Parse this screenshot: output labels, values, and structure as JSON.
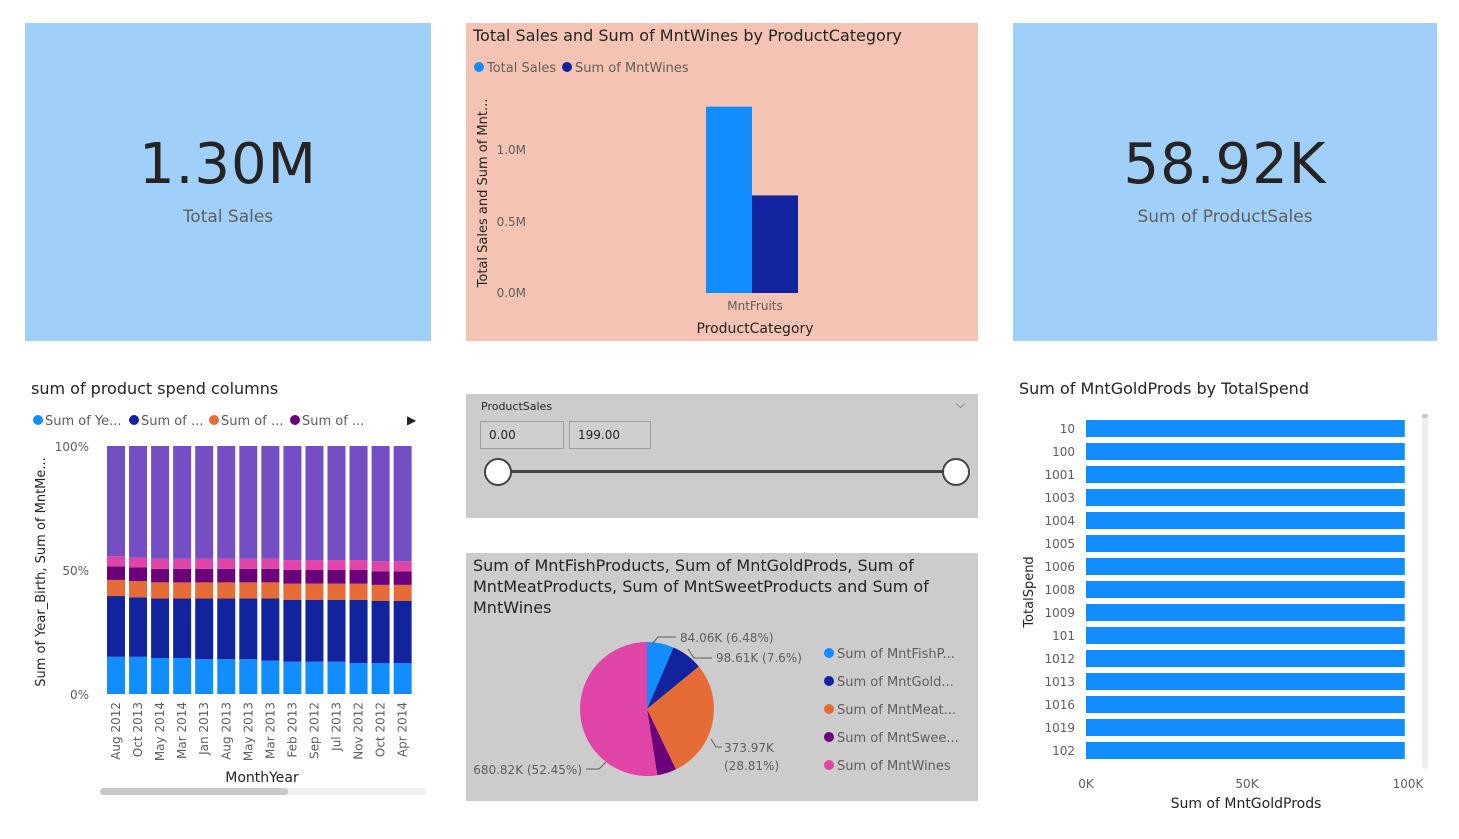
{
  "cards": [
    {
      "value": "1.30M",
      "label": "Total Sales"
    },
    {
      "value": "58.92K",
      "label": "Sum of ProductSales"
    }
  ],
  "colors": {
    "blue": "#118dff",
    "dark_blue": "#12239e",
    "orange": "#e66c37",
    "purple": "#6b007b",
    "pink": "#e044a7",
    "violet": "#744ec2",
    "card_bg": "#a0cff9",
    "salmon_bg": "#f4c3b3",
    "gray_bg": "#cccccc"
  },
  "chart_data": [
    {
      "id": "category_bar",
      "type": "bar",
      "title": "Total Sales and Sum of MntWines by ProductCategory",
      "legend": [
        "Total Sales",
        "Sum of MntWines"
      ],
      "legend_position": "top-left",
      "categories": [
        "MntFruits"
      ],
      "series": [
        {
          "name": "Total Sales",
          "values": [
            1300000
          ]
        },
        {
          "name": "Sum of MntWines",
          "values": [
            680820
          ]
        }
      ],
      "xlabel": "ProductCategory",
      "ylabel": "Total Sales and Sum of Mnt...",
      "yticks": [
        "0.0M",
        "0.5M",
        "1.0M"
      ],
      "ylim": [
        0,
        1500000
      ]
    },
    {
      "id": "stacked_100",
      "type": "bar",
      "stacking": "percent",
      "title": "sum of product spend columns",
      "legend": [
        "Sum of Ye...",
        "Sum of ...",
        "Sum of ...",
        "Sum of ..."
      ],
      "categories": [
        "Aug 2012",
        "Oct 2013",
        "May 2014",
        "Mar 2014",
        "Jan 2013",
        "Aug 2013",
        "May 2013",
        "Mar 2013",
        "Feb 2013",
        "Sep 2012",
        "Jul 2013",
        "Nov 2012",
        "Oct 2012",
        "Apr 2014"
      ],
      "series_colors": [
        "#118dff",
        "#12239e",
        "#e66c37",
        "#6b007b",
        "#e044a7",
        "#744ec2"
      ],
      "series": [
        {
          "values": [
            15,
            15,
            14.5,
            14.5,
            14,
            14,
            14,
            13.5,
            13,
            13,
            13,
            12.5,
            12.5,
            12.5
          ]
        },
        {
          "values": [
            24.5,
            24,
            24,
            24,
            24.5,
            24.5,
            24.5,
            25,
            25,
            25,
            25,
            25.5,
            25,
            25
          ]
        },
        {
          "values": [
            6.5,
            6.5,
            6.5,
            6.5,
            6.5,
            6.5,
            6.5,
            6.5,
            6.5,
            6.5,
            6.5,
            6.5,
            6.5,
            6.5
          ]
        },
        {
          "values": [
            5.5,
            5.5,
            5.5,
            5.5,
            5.5,
            5.5,
            5.5,
            5.5,
            5.5,
            5.5,
            5.5,
            5.5,
            5.5,
            5.5
          ]
        },
        {
          "values": [
            4,
            4,
            4,
            4,
            4,
            4,
            4,
            4,
            4,
            4,
            4,
            4,
            4,
            4
          ]
        },
        {
          "values": [
            44.5,
            45,
            45.5,
            45.5,
            45.5,
            45.5,
            45.5,
            45.5,
            46,
            46,
            46,
            46,
            46.5,
            46.5
          ]
        }
      ],
      "xlabel": "MonthYear",
      "ylabel": "Sum of Year_Birth, Sum of MntMe...",
      "yticks": [
        "0%",
        "50%",
        "100%"
      ],
      "ylim": [
        0,
        100
      ]
    },
    {
      "id": "pie",
      "type": "pie",
      "title": "Sum of MntFishProducts, Sum of MntGoldProds, Sum of MntMeatProducts, Sum of MntSweetProducts and Sum of MntWines",
      "title_lines": [
        "Sum of MntFishProducts, Sum of MntGoldProds, Sum of",
        "MntMeatProducts, Sum of MntSweetProducts and Sum of",
        "MntWines"
      ],
      "legend": [
        "Sum of MntFishP...",
        "Sum of MntGold...",
        "Sum of MntMeat...",
        "Sum of MntSwee...",
        "Sum of MntWines"
      ],
      "slices": [
        {
          "value": 6.48,
          "label": "84.06K (6.48%)",
          "color": "#118dff"
        },
        {
          "value": 7.6,
          "label": "98.61K (7.6%)",
          "color": "#12239e"
        },
        {
          "value": 28.81,
          "label_lines": [
            "373.97K",
            "(28.81%)"
          ],
          "color": "#e66c37"
        },
        {
          "value": 4.66,
          "color": "#6b007b"
        },
        {
          "value": 52.45,
          "label": "680.82K (52.45%)",
          "color": "#e044a7"
        }
      ]
    },
    {
      "id": "hbar",
      "type": "bar",
      "orientation": "horizontal",
      "title": "Sum of MntGoldProds by TotalSpend",
      "categories": [
        "10",
        "100",
        "1001",
        "1003",
        "1004",
        "1005",
        "1006",
        "1008",
        "1009",
        "101",
        "1012",
        "1013",
        "1016",
        "1019",
        "102"
      ],
      "values": [
        99000,
        99000,
        99000,
        99000,
        99000,
        99000,
        99000,
        99000,
        99000,
        99000,
        99000,
        99000,
        99000,
        99000,
        99000
      ],
      "xlabel": "Sum of MntGoldProds",
      "ylabel": "TotalSpend",
      "xticks": [
        "0K",
        "50K",
        "100K"
      ],
      "xlim": [
        0,
        100000
      ]
    }
  ],
  "slicer": {
    "title": "ProductSales",
    "min": "0.00",
    "max": "199.00"
  }
}
